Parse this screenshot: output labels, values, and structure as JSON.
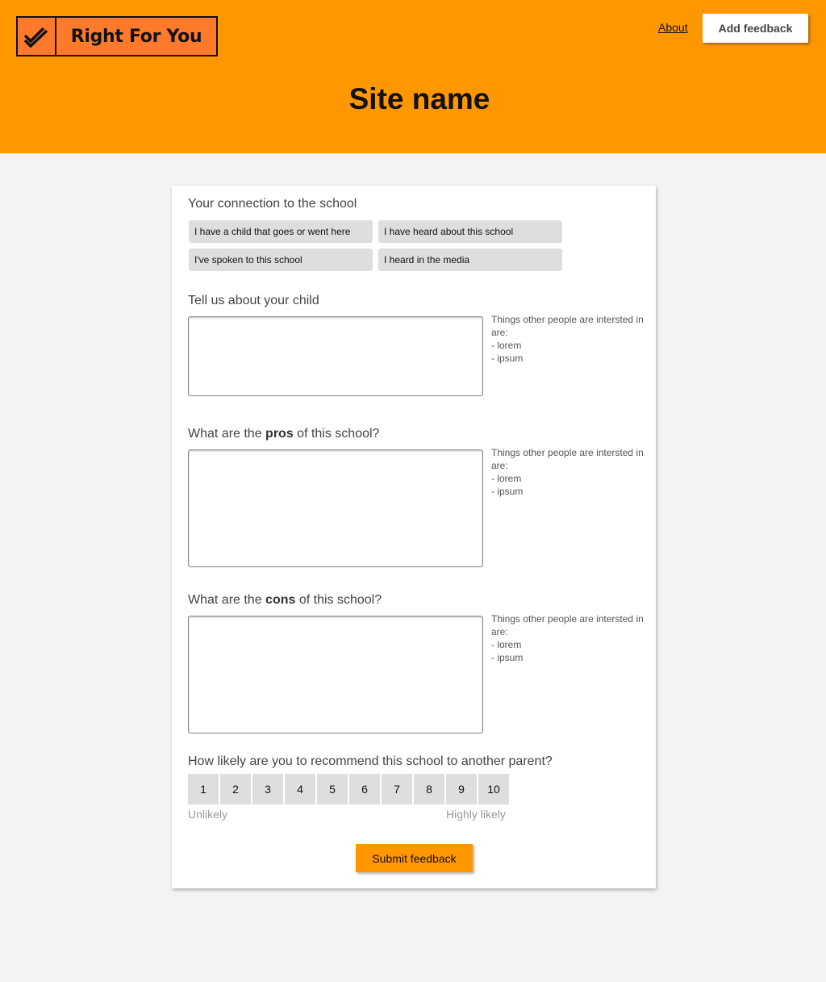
{
  "header": {
    "logo_text": "Right For You",
    "logo_icon": "double-check-icon",
    "about_link": "About",
    "add_feedback_button": "Add feedback",
    "site_title": "Site name"
  },
  "form": {
    "connection": {
      "label": "Your connection to the school",
      "options": [
        "I have a child that goes or went here",
        "I have heard about this school",
        "I've spoken to this school",
        "I heard in the media"
      ]
    },
    "child": {
      "label": "Tell us about your child",
      "value": "",
      "hint_title": "Things other people are intersted in are:",
      "hint_items": [
        "- lorem",
        "- ipsum"
      ]
    },
    "pros": {
      "label_before": "What are the ",
      "label_bold": "pros",
      "label_after": " of this school?",
      "value": "",
      "hint_title": "Things other people are intersted in are:",
      "hint_items": [
        "- lorem",
        "- ipsum"
      ]
    },
    "cons": {
      "label_before": "What are the ",
      "label_bold": "cons",
      "label_after": " of this school?",
      "value": "",
      "hint_title": "Things other people are intersted in are:",
      "hint_items": [
        "- lorem",
        "- ipsum"
      ]
    },
    "recommend": {
      "label": "How likely are you to recommend this school to another parent?",
      "options": [
        "1",
        "2",
        "3",
        "4",
        "5",
        "6",
        "7",
        "8",
        "9",
        "10"
      ],
      "low_label": "Unlikely",
      "high_label": "Highly likely"
    },
    "submit_label": "Submit feedback"
  },
  "colors": {
    "header_bg": "#ff9700",
    "logo_bg": "#ff7a2a",
    "page_bg": "#f3f3f3",
    "button_grey": "#dedede"
  }
}
